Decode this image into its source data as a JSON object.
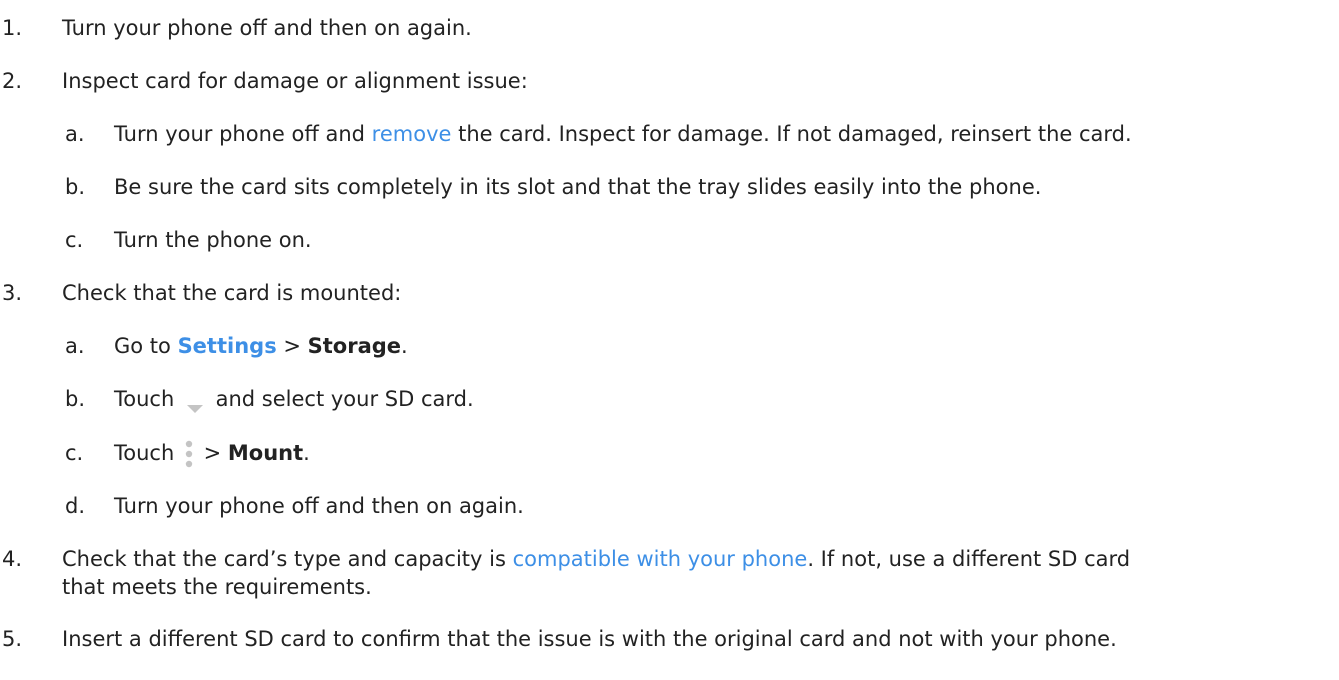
{
  "colors": {
    "text": "#222222",
    "link": "#3d8fe6",
    "icon": "#c4c4c4"
  },
  "steps": [
    {
      "number": "1.",
      "text": "Turn your phone off and then on again."
    },
    {
      "number": "2.",
      "text": "Inspect card for damage or alignment issue:",
      "substeps": [
        {
          "letter": "a.",
          "pre": "Turn your phone off and ",
          "link": "remove",
          "post": " the card. Inspect for damage. If not damaged, reinsert the card."
        },
        {
          "letter": "b.",
          "text": "Be sure the card sits completely in its slot and that the tray slides easily into the phone."
        },
        {
          "letter": "c.",
          "text": "Turn the phone on."
        }
      ]
    },
    {
      "number": "3.",
      "text": "Check that the card is mounted:",
      "substeps": [
        {
          "letter": "a.",
          "pre": "Go to ",
          "settings_link": "Settings",
          "sep": " > ",
          "storage": "Storage",
          "end": "."
        },
        {
          "letter": "b.",
          "pre": "Touch ",
          "icon": "dropdown-arrow-icon",
          "post": " and select your SD card."
        },
        {
          "letter": "c.",
          "pre": "Touch ",
          "icon": "overflow-menu-icon",
          "sep": " > ",
          "mount": "Mount",
          "end": "."
        },
        {
          "letter": "d.",
          "text": "Turn your phone off and then on again."
        }
      ]
    },
    {
      "number": "4.",
      "pre": "Check that the card’s type and capacity is ",
      "link": "compatible with your phone",
      "post": ". If not, use a different SD card",
      "line2": "that meets the requirements."
    },
    {
      "number": "5.",
      "text": "Insert a different SD card to confirm that the issue is with the original card and not with your phone."
    }
  ]
}
